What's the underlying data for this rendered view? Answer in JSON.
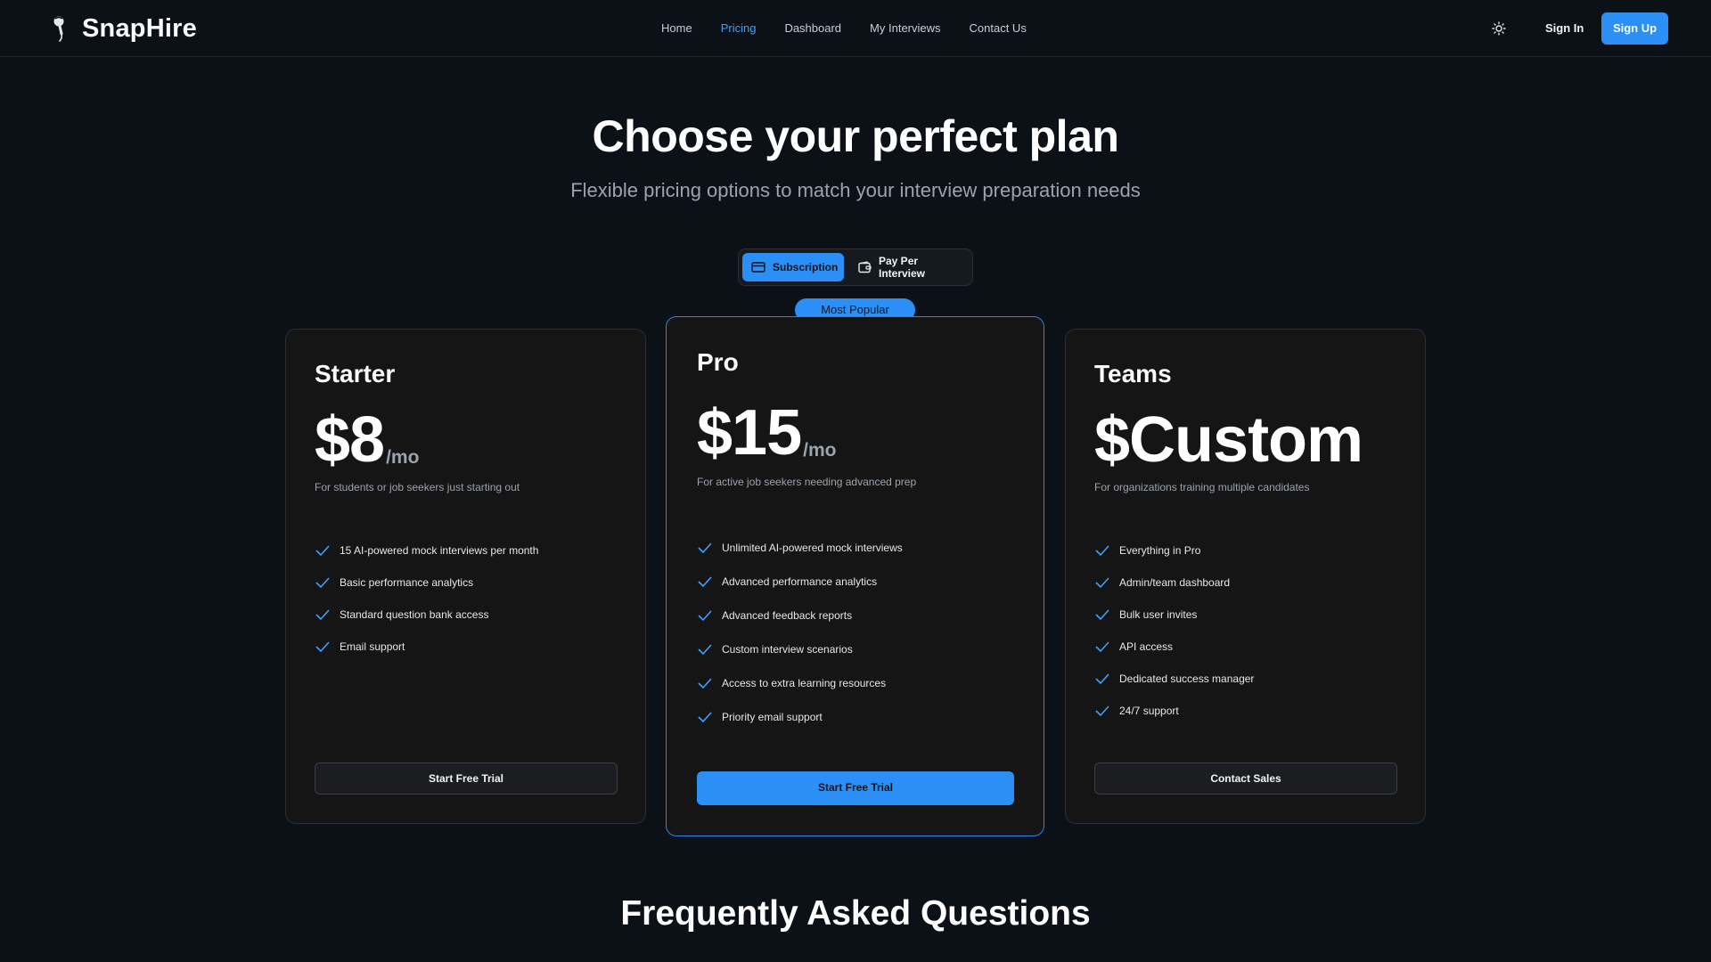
{
  "header": {
    "brand": "SnapHire",
    "nav": [
      {
        "label": "Home",
        "active": false
      },
      {
        "label": "Pricing",
        "active": true
      },
      {
        "label": "Dashboard",
        "active": false
      },
      {
        "label": "My Interviews",
        "active": false
      },
      {
        "label": "Contact Us",
        "active": false
      }
    ],
    "sign_in": "Sign In",
    "sign_up": "Sign Up"
  },
  "hero": {
    "title": "Choose your perfect plan",
    "subtitle": "Flexible pricing options to match your interview preparation needs"
  },
  "billing_toggle": {
    "options": [
      {
        "label": "Subscription",
        "icon": "credit-card-icon",
        "selected": true
      },
      {
        "label": "Pay Per Interview",
        "icon": "wallet-icon",
        "selected": false
      }
    ]
  },
  "plans": {
    "starter": {
      "name": "Starter",
      "price": "$8",
      "unit": "/mo",
      "description": "For students or job seekers just starting out",
      "features": [
        "15 AI-powered mock interviews per month",
        "Basic performance analytics",
        "Standard question bank access",
        "Email support"
      ],
      "cta": "Start Free Trial"
    },
    "pro": {
      "badge": "Most Popular",
      "name": "Pro",
      "price": "$15",
      "unit": "/mo",
      "description": "For active job seekers needing advanced prep",
      "features": [
        "Unlimited AI-powered mock interviews",
        "Advanced performance analytics",
        "Advanced feedback reports",
        "Custom interview scenarios",
        "Access to extra learning resources",
        "Priority email support"
      ],
      "cta": "Start Free Trial"
    },
    "teams": {
      "name": "Teams",
      "price": "$Custom",
      "description": "For organizations training multiple candidates",
      "features": [
        "Everything in Pro",
        "Admin/team dashboard",
        "Bulk user invites",
        "API access",
        "Dedicated success manager",
        "24/7 support"
      ],
      "cta": "Contact Sales"
    }
  },
  "faq": {
    "title": "Frequently Asked Questions"
  },
  "colors": {
    "background": "#0c1118",
    "accent": "#2b8ff5",
    "card": "#151515"
  }
}
